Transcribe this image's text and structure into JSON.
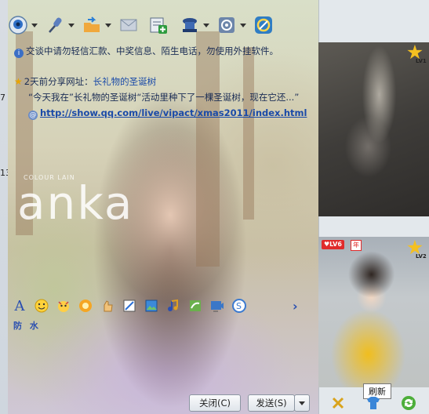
{
  "left_strip": {
    "glyph_a": "7",
    "glyph_b": "13"
  },
  "toolbar": {
    "items": [
      {
        "name": "video-call-icon",
        "color": "#3a7bd5",
        "has_menu": true
      },
      {
        "name": "microphone-icon",
        "color": "#4a6fb5",
        "has_menu": true
      },
      {
        "name": "send-file-icon",
        "color": "#e6902a",
        "has_menu": true
      },
      {
        "name": "mail-icon",
        "color": "#7f8fa4",
        "has_menu": false
      },
      {
        "name": "create-group-icon",
        "color": "#2d8a3e",
        "has_menu": false
      },
      {
        "name": "remote-assist-icon",
        "color": "#2b4d8c",
        "has_menu": true
      },
      {
        "name": "app-center-icon",
        "color": "#4b6fa0",
        "has_menu": true
      },
      {
        "name": "browser-icon",
        "color": "#2f7dc4",
        "has_menu": false
      }
    ]
  },
  "messages": {
    "safety_notice": "交谈中请勿轻信汇款、中奖信息、陌生电话，勿使用外挂软件。",
    "share_prefix": "2天前分享网址：",
    "share_title": "长礼物的圣诞树",
    "share_desc": "“今天我在”长礼物的圣诞树“活动里种下了一棵圣诞树，现在它还...”",
    "share_url": "http://show.qq.com/live/vipact/xmas2011/index.html"
  },
  "skin": {
    "watermark": "anka",
    "watermark_small": "COLOUR LAIN"
  },
  "format_toolbar": {
    "items": [
      "font-icon",
      "emoticon-icon",
      "magic-face-icon",
      "sticker-icon",
      "shake-window-icon",
      "screenshot-icon",
      "image-icon",
      "music-icon",
      "doodle-icon",
      "video-snapshot-icon",
      "smart-tips-icon"
    ],
    "more_arrow": "›"
  },
  "anti_spam_label": "防 水",
  "buttons": {
    "close": "关闭(C)",
    "send": "发送(S)"
  },
  "right_panel": {
    "top_level": "LV1",
    "bottom_level": "LV2",
    "lv6_badge": "LV6",
    "nian_badge": "年",
    "tooltip": "刷新"
  },
  "bottom_icons": [
    "collapse-icon",
    "shirt-icon",
    "refresh-icon"
  ]
}
